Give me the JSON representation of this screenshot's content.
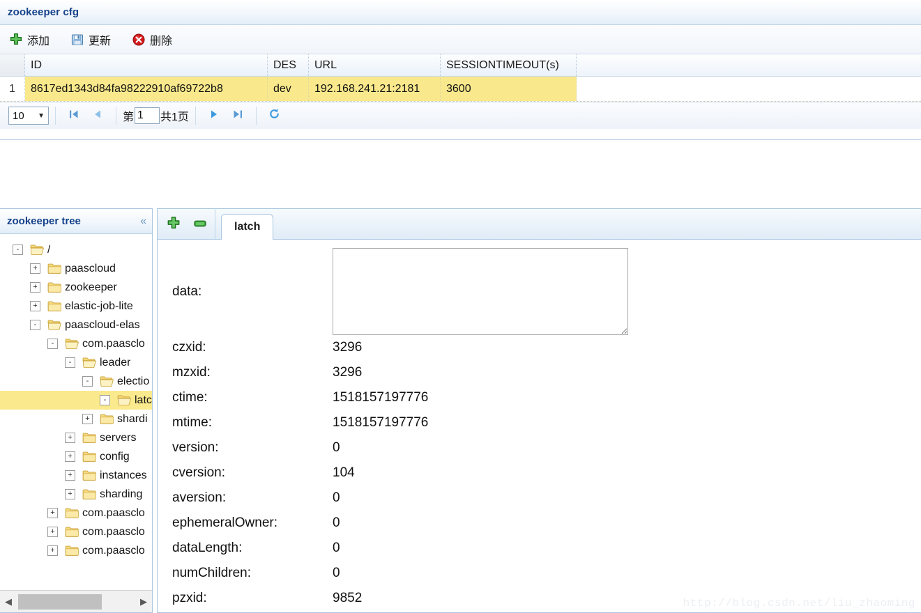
{
  "cfg_panel": {
    "title": "zookeeper cfg",
    "toolbar": [
      {
        "label": "添加",
        "icon": "add-icon"
      },
      {
        "label": "更新",
        "icon": "save-icon"
      },
      {
        "label": "删除",
        "icon": "delete-icon"
      }
    ],
    "grid": {
      "columns": [
        "",
        "ID",
        "DES",
        "URL",
        "SESSIONTIMEOUT(s)",
        ""
      ],
      "rows": [
        {
          "num": "1",
          "id": "8617ed1343d84fa98222910af69722b8",
          "des": "dev",
          "url": "192.168.241.21:2181",
          "sessiontimeout": "3600",
          "selected": true
        }
      ]
    },
    "pager": {
      "page_size": "10",
      "page_size_caret": "▼",
      "first_icon": "first-page-icon",
      "prev_icon": "prev-page-icon",
      "prefix_label": "第",
      "page_number": "1",
      "suffix_label": "共1页",
      "next_icon": "next-page-icon",
      "last_icon": "last-page-icon",
      "refresh_icon": "refresh-icon"
    }
  },
  "tree_panel": {
    "title": "zookeeper tree",
    "collapse_icon": "«",
    "nodes": [
      {
        "label": "/",
        "depth": 0,
        "toggle": "-",
        "open": true,
        "selected": false
      },
      {
        "label": "paascloud",
        "depth": 1,
        "toggle": "+",
        "open": false,
        "selected": false
      },
      {
        "label": "zookeeper",
        "depth": 1,
        "toggle": "+",
        "open": false,
        "selected": false
      },
      {
        "label": "elastic-job-lite",
        "depth": 1,
        "toggle": "+",
        "open": false,
        "selected": false
      },
      {
        "label": "paascloud-elas",
        "depth": 1,
        "toggle": "-",
        "open": true,
        "selected": false
      },
      {
        "label": "com.paasclo",
        "depth": 2,
        "toggle": "-",
        "open": true,
        "selected": false
      },
      {
        "label": "leader",
        "depth": 3,
        "toggle": "-",
        "open": true,
        "selected": false
      },
      {
        "label": "electio",
        "depth": 4,
        "toggle": "-",
        "open": true,
        "selected": false
      },
      {
        "label": "latc",
        "depth": 5,
        "toggle": "-",
        "open": true,
        "selected": true
      },
      {
        "label": "shardi",
        "depth": 4,
        "toggle": "+",
        "open": false,
        "selected": false
      },
      {
        "label": "servers",
        "depth": 3,
        "toggle": "+",
        "open": false,
        "selected": false
      },
      {
        "label": "config",
        "depth": 3,
        "toggle": "+",
        "open": false,
        "selected": false
      },
      {
        "label": "instances",
        "depth": 3,
        "toggle": "+",
        "open": false,
        "selected": false
      },
      {
        "label": "sharding",
        "depth": 3,
        "toggle": "+",
        "open": false,
        "selected": false
      },
      {
        "label": "com.paasclo",
        "depth": 2,
        "toggle": "+",
        "open": false,
        "selected": false
      },
      {
        "label": "com.paasclo",
        "depth": 2,
        "toggle": "+",
        "open": false,
        "selected": false
      },
      {
        "label": "com.paasclo",
        "depth": 2,
        "toggle": "+",
        "open": false,
        "selected": false
      }
    ],
    "hscroll": {
      "left_arrow": "◀",
      "right_arrow": "▶"
    }
  },
  "detail_panel": {
    "tools": [
      {
        "icon": "add-node-icon"
      },
      {
        "icon": "remove-node-icon"
      }
    ],
    "tabs": [
      {
        "label": "latch",
        "active": true
      }
    ],
    "fields": [
      {
        "label": "data:",
        "value": "",
        "type": "textarea"
      },
      {
        "label": "czxid:",
        "value": "3296",
        "type": "text"
      },
      {
        "label": "mzxid:",
        "value": "3296",
        "type": "text"
      },
      {
        "label": "ctime:",
        "value": "1518157197776",
        "type": "text"
      },
      {
        "label": "mtime:",
        "value": "1518157197776",
        "type": "text"
      },
      {
        "label": "version:",
        "value": "0",
        "type": "text"
      },
      {
        "label": "cversion:",
        "value": "104",
        "type": "text"
      },
      {
        "label": "aversion:",
        "value": "0",
        "type": "text"
      },
      {
        "label": "ephemeralOwner:",
        "value": "0",
        "type": "text"
      },
      {
        "label": "dataLength:",
        "value": "0",
        "type": "text"
      },
      {
        "label": "numChildren:",
        "value": "0",
        "type": "text"
      },
      {
        "label": "pzxid:",
        "value": "9852",
        "type": "text"
      }
    ]
  },
  "watermark": {
    "text": "http://blog.csdn.net/liu_zhaoming"
  },
  "colors": {
    "accent": "#15428b",
    "panel_border": "#a8c6e0",
    "row_highlight": "#f9e98c",
    "tree_selected": "#fae98d",
    "header_gradient_top": "#ffffff",
    "header_gradient_bottom": "#e2edf8"
  }
}
